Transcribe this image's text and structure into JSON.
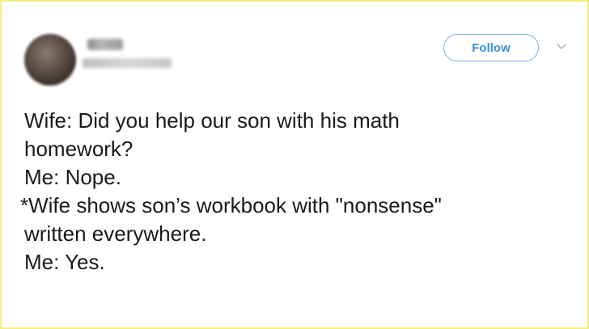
{
  "header": {
    "follow_label": "Follow"
  },
  "icons": {
    "avatar": "avatar",
    "more": "chevron-down-icon"
  },
  "colors": {
    "frame_border": "#f5ee7e",
    "follow_text": "#3b8fd6",
    "follow_border": "#79b0e5",
    "tweet_text": "#1a1a1a"
  },
  "tweet": {
    "lines": [
      "Wife: Did you help our son with his math",
      "homework?",
      "Me: Nope.",
      "*Wife shows son’s workbook with \"nonsense\"",
      "written everywhere.",
      "Me: Yes."
    ]
  }
}
